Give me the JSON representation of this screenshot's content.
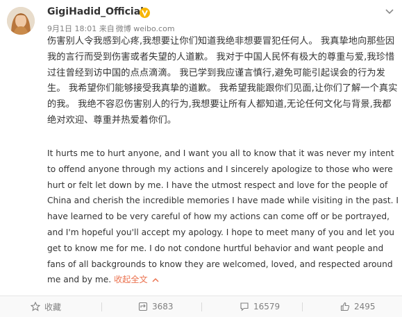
{
  "post": {
    "username": "GigiHadid_Official",
    "date": "9月1日 18:01",
    "source_prefix": "来自",
    "source": "微博 weibo.com",
    "text_cn": "伤害别人令我感到心疼,我想要让你们知道我绝非想要冒犯任何人。 我真挚地向那些因我的言行而受到伤害或者失望的人道歉。 我对于中国人民怀有极大的尊重与爱,我珍惜过往曾经到访中国的点点滴滴。 我已学到我应谨言慎行,避免可能引起误会的行为发生。 我希望你们能够接受我真挚的道歉。 我希望我能跟你们见面,让你们了解一个真实的我。 我绝不容忍伤害别人的行为,我想要让所有人都知道,无论任何文化与背景,我都绝对欢迎、尊重并热爱着你们。",
    "text_en": "It hurts me to hurt anyone, and I want you all to know that it was never my intent to offend anyone through my actions and I sincerely apologize to those who were hurt or felt let down by me. I have the utmost respect and love for the people of China and cherish the incredible memories I have made while visiting in the past. I have learned to be very careful of how my actions can come off or be portrayed, and I'm hopeful you'll accept my apology. I hope to meet many of you and let you get to know me for me. I do not condone hurtful behavior and want people and fans of all backgrounds to know they are welcomed, loved, and respected around me and by me.",
    "collapse_label": "收起全文"
  },
  "actions": {
    "favorite_label": "收藏",
    "repost_count": "3683",
    "comment_count": "16579",
    "like_count": "2495"
  },
  "icons": {
    "verified": "verified-badge-icon",
    "menu": "chevron-down-icon",
    "favorite": "star-icon",
    "repost": "repost-icon",
    "comment": "comment-icon",
    "like": "thumbs-up-icon"
  },
  "colors": {
    "link": "#eb7350",
    "verified": "#f7b500",
    "muted": "#808080"
  }
}
